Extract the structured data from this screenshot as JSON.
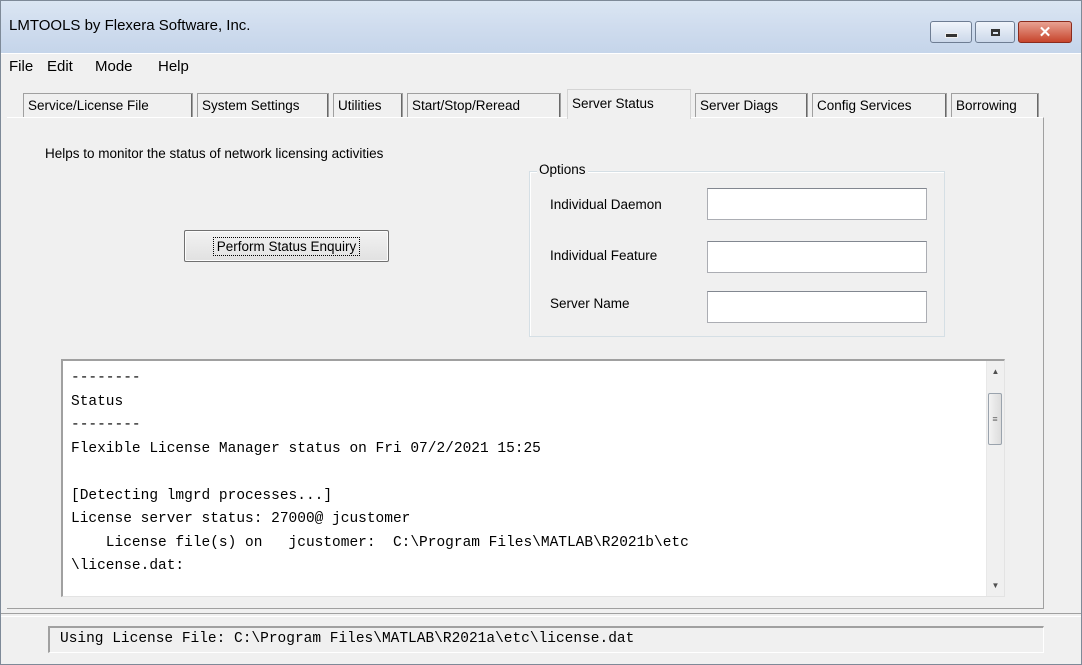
{
  "window": {
    "title": "LMTOOLS by Flexera Software, Inc.",
    "controls": {
      "minimize": "minimize-icon",
      "maximize": "maximize-icon",
      "close": "close-icon",
      "close_glyph": "✕"
    }
  },
  "menu": {
    "items": [
      "File",
      "Edit",
      "Mode",
      "Help"
    ]
  },
  "tabs": {
    "items": [
      {
        "label": "Service/License File"
      },
      {
        "label": "System Settings"
      },
      {
        "label": "Utilities"
      },
      {
        "label": "Start/Stop/Reread"
      },
      {
        "label": "Server Status",
        "active": true
      },
      {
        "label": "Server Diags"
      },
      {
        "label": "Config Services"
      },
      {
        "label": "Borrowing"
      }
    ]
  },
  "server_status": {
    "helper_text": "Helps to monitor the status of network licensing activities",
    "perform_button": "Perform Status Enquiry",
    "options": {
      "legend": "Options",
      "individual_daemon_label": "Individual Daemon",
      "individual_daemon_value": "",
      "individual_feature_label": "Individual Feature",
      "individual_feature_value": "",
      "server_name_label": "Server Name",
      "server_name_value": ""
    },
    "output_lines": [
      "--------",
      "Status",
      "--------",
      "Flexible License Manager status on Fri 07/2/2021 15:25",
      "",
      "[Detecting lmgrd processes...]",
      "License server status: 27000@ jcustomer",
      "    License file(s) on   jcustomer:  C:\\Program Files\\MATLAB\\R2021b\\etc",
      "\\license.dat:"
    ],
    "scroll_up_glyph": "▲",
    "scroll_down_glyph": "▼",
    "scroll_thumb_glyph": "≡"
  },
  "status_bar": {
    "text": "Using License File: C:\\Program Files\\MATLAB\\R2021a\\etc\\license.dat"
  }
}
